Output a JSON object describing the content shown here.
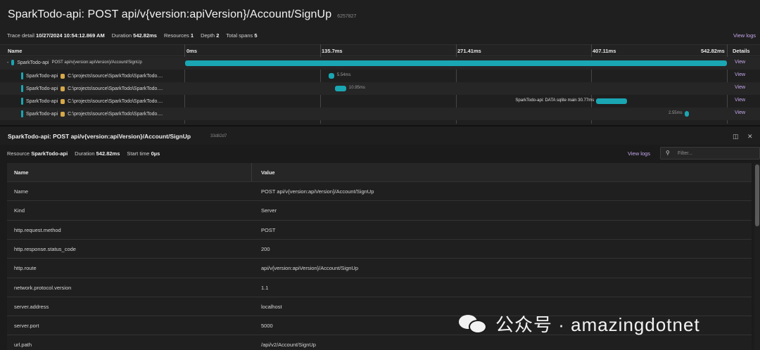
{
  "header": {
    "title": "SparkTodo-api: POST api/v{version:apiVersion}/Account/SignUp",
    "trace_id": "6257827",
    "trace_detail_label": "Trace detail",
    "trace_detail_value": "10/27/2024 10:54:12.869 AM",
    "duration_label": "Duration",
    "duration_value": "542.82ms",
    "resources_label": "Resources",
    "resources_value": "1",
    "depth_label": "Depth",
    "depth_value": "2",
    "total_spans_label": "Total spans",
    "total_spans_value": "5",
    "view_logs": "View logs"
  },
  "timeline": {
    "name_col": "Name",
    "details_col": "Details",
    "ticks": [
      "0ms",
      "135.7ms",
      "271.41ms",
      "407.11ms",
      "542.82ms"
    ],
    "total_ms": 542.82,
    "rows": [
      {
        "service": "SparkTodo-api",
        "collapse": "-",
        "label": "POST api/v{version:apiVersion}/Account/SignUp",
        "start_ms": 0,
        "duration_ms": 542.82,
        "bar_label": "",
        "view": "View"
      },
      {
        "service": "SparkTodo-api",
        "path": "C:\\projects\\source\\SparkTodo\\SparkTodo....",
        "start_ms": 143.8,
        "duration_ms": 5.54,
        "bar_label": "5.54ms",
        "view": "View"
      },
      {
        "service": "SparkTodo-api",
        "path": "C:\\projects\\source\\SparkTodo\\SparkTodo....",
        "start_ms": 150.4,
        "duration_ms": 10.95,
        "bar_label": "10.95ms",
        "view": "View"
      },
      {
        "service": "SparkTodo-api",
        "path": "C:\\projects\\source\\SparkTodo\\SparkTodo....",
        "start_ms": 412.0,
        "duration_ms": 30.77,
        "bar_label": "SparkTodo-api: DATA sqlite main 30.77ms",
        "view": "View"
      },
      {
        "service": "SparkTodo-api",
        "path": "C:\\projects\\source\\SparkTodo\\SparkTodo....",
        "start_ms": 500.5,
        "duration_ms": 2.55,
        "bar_label": "2.55ms",
        "view": "View"
      }
    ]
  },
  "detail": {
    "title": "SparkTodo-api: POST api/v{version:apiVersion}/Account/SignUp",
    "span_id": "33d82d7",
    "resource_label": "Resource",
    "resource_value": "SparkTodo-api",
    "duration_label": "Duration",
    "duration_value": "542.82ms",
    "start_label": "Start time",
    "start_value": "0µs",
    "view_logs": "View logs",
    "filter_placeholder": "Filter...",
    "col_name": "Name",
    "col_value": "Value",
    "rows": [
      {
        "name": "Name",
        "value": "POST api/v{version:apiVersion}/Account/SignUp"
      },
      {
        "name": "Kind",
        "value": "Server"
      },
      {
        "name": "http.request.method",
        "value": "POST"
      },
      {
        "name": "http.response.status_code",
        "value": "200"
      },
      {
        "name": "http.route",
        "value": "api/v{version:apiVersion}/Account/SignUp"
      },
      {
        "name": "network.protocol.version",
        "value": "1.1"
      },
      {
        "name": "server.address",
        "value": "localhost"
      },
      {
        "name": "server.port",
        "value": "5000"
      },
      {
        "name": "url.path",
        "value": "/api/v2/Account/SignUp"
      }
    ]
  },
  "watermark": {
    "text": "公众号 · amazingdotnet"
  },
  "colors": {
    "accent_bar": "#1aa6b3",
    "link": "#c8a8f0"
  }
}
